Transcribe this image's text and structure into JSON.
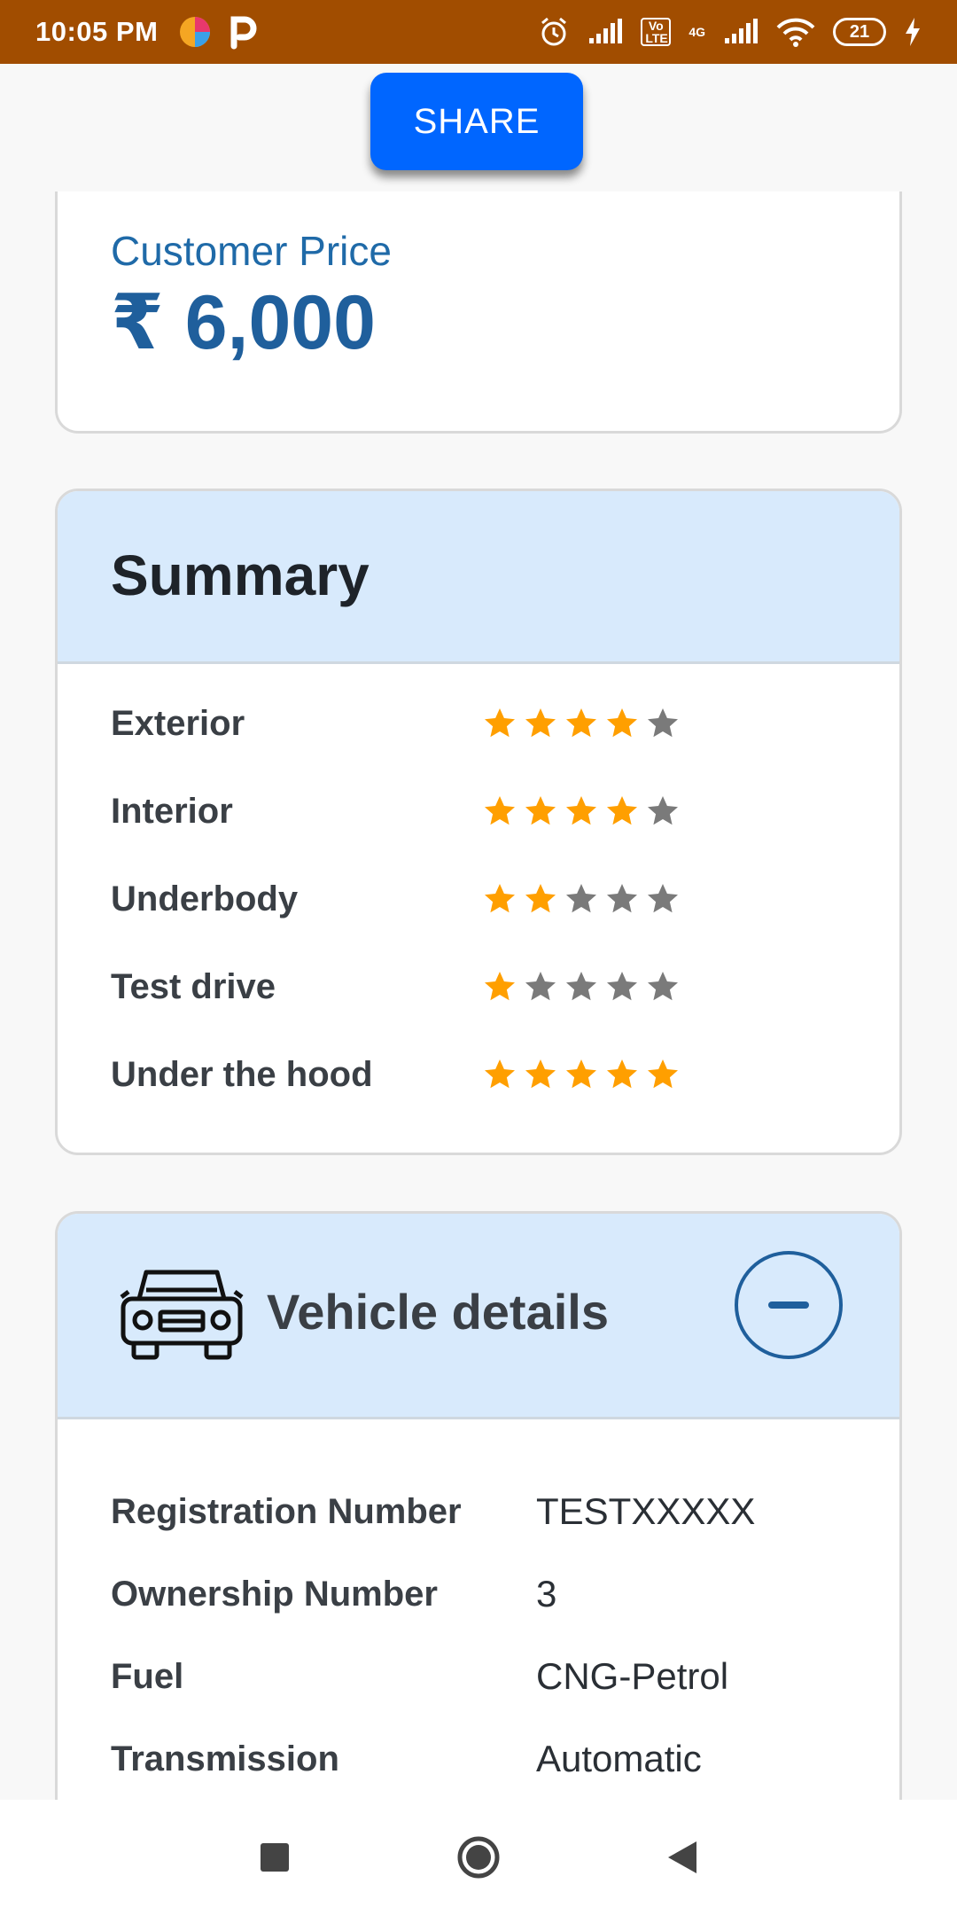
{
  "status_bar": {
    "time": "10:05 PM",
    "battery": "21",
    "network": "4G",
    "volte": "Vo LTE"
  },
  "toolbar": {
    "share_label": "SHARE"
  },
  "price": {
    "label": "Customer Price",
    "value": "₹ 6,000"
  },
  "summary": {
    "title": "Summary",
    "ratings": [
      {
        "label": "Exterior",
        "stars": 4,
        "max": 5
      },
      {
        "label": "Interior",
        "stars": 4,
        "max": 5
      },
      {
        "label": "Underbody",
        "stars": 2,
        "max": 5
      },
      {
        "label": "Test drive",
        "stars": 1,
        "max": 5
      },
      {
        "label": "Under the hood",
        "stars": 5,
        "max": 5
      }
    ]
  },
  "vehicle": {
    "title": "Vehicle details",
    "icon": "car-icon",
    "rows": [
      {
        "label": "Registration Number",
        "value": "TESTXXXXX"
      },
      {
        "label": "Ownership Number",
        "value": "3"
      },
      {
        "label": "Fuel",
        "value": "CNG-Petrol"
      },
      {
        "label": "Transmission",
        "value": "Automatic"
      }
    ]
  },
  "colors": {
    "status_bar": "#a14d00",
    "share_button": "#0066ff",
    "accent": "#1f5f9c",
    "header_bg": "#d8eafc",
    "star_filled": "#ff9f00",
    "star_empty": "#7a7a7a"
  }
}
